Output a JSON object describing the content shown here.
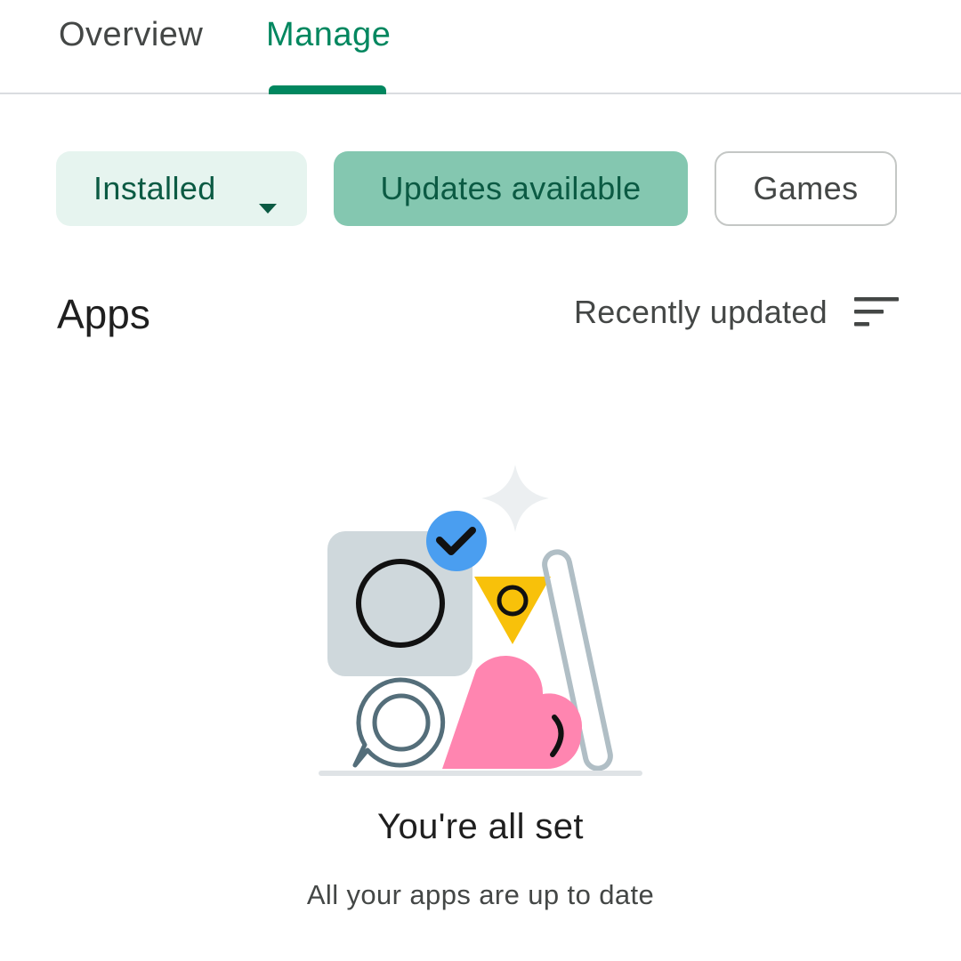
{
  "tabs": [
    {
      "label": "Overview",
      "selected": false
    },
    {
      "label": "Manage",
      "selected": true
    }
  ],
  "filters": {
    "installed_label": "Installed",
    "updates_label": "Updates available",
    "games_label": "Games"
  },
  "section": {
    "title": "Apps",
    "sort_label": "Recently updated"
  },
  "empty_state": {
    "title": "You're all set",
    "subtitle": "All your apps are up to date"
  },
  "colors": {
    "accent": "#01875f",
    "chip_installed_bg": "#e6f4ef",
    "chip_selected_bg": "#84c7b0",
    "text_primary": "#1f1f1f",
    "text_secondary": "#444746"
  },
  "icons": {
    "installed_dropdown": "arrow-drop-down-icon",
    "sort": "sort-lines-icon",
    "illustration": "all-set-illustration"
  }
}
